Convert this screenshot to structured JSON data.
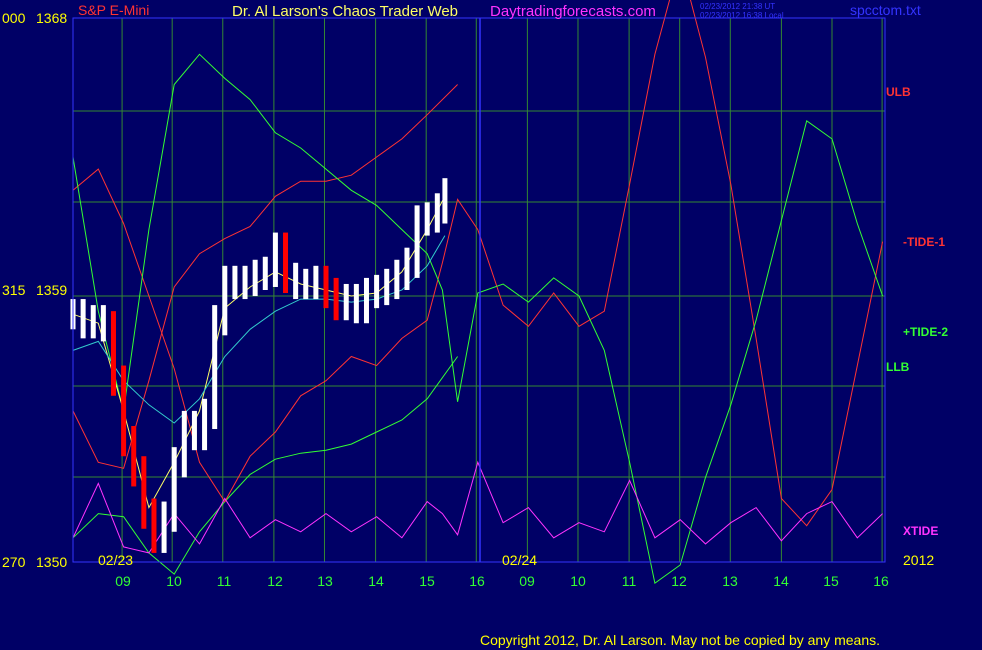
{
  "header": {
    "symbol": "S&P E-Mini",
    "title": "Dr. Al Larson's Chaos Trader Web",
    "site": "Daytradingforecasts.com",
    "timestamp_ut": "02/23/2012 21:38 UT",
    "timestamp_local": "02/23/2012 16:38 Local",
    "filename": "spcctom.txt"
  },
  "copyright": "Copyright 2012, Dr. Al Larson. May not be copied by any means.",
  "colors": {
    "background": "#000066",
    "frame": "#3333ff",
    "grid": "#338833",
    "axis_label": "#ffff00",
    "time_label": "#33ff33",
    "price_bars_up": "#ffffff",
    "price_bars_down": "#ff0000",
    "ulb": "#ff3333",
    "tide1": "#ff3333",
    "tide2": "#33ff33",
    "llb": "#33ff33",
    "xtide": "#ff33ff",
    "moving_avg_fast": "#ffff66",
    "moving_avg_slow": "#33cccc",
    "copyright": "#ffff00",
    "site": "#ff33ff",
    "title": "#ffff66",
    "symbol": "#ff3333"
  },
  "chart_data": {
    "type": "line",
    "y_axis": {
      "ticks": [
        {
          "left": "000",
          "right": "1368",
          "value": 1368
        },
        {
          "left": "315",
          "right": "1359",
          "value": 1359
        },
        {
          "left": "270",
          "right": "1350",
          "value": 1350
        }
      ],
      "ylim": [
        1350,
        1368
      ]
    },
    "x_axis": {
      "ticks": [
        "09",
        "10",
        "11",
        "12",
        "13",
        "14",
        "15",
        "16",
        "09",
        "10",
        "11",
        "12",
        "13",
        "14",
        "15",
        "16"
      ],
      "date_labels": [
        "02/23",
        "02/24"
      ],
      "year_label": "2012"
    },
    "series_labels": [
      {
        "name": "ULB",
        "color": "#ff3333"
      },
      {
        "name": "-TIDE-1",
        "color": "#ff3333"
      },
      {
        "name": "+TIDE-2",
        "color": "#33ff33"
      },
      {
        "name": "LLB",
        "color": "#33ff33"
      },
      {
        "name": "XTIDE",
        "color": "#ff33ff"
      }
    ],
    "series": [
      {
        "name": "ULB",
        "x": [
          0,
          0.5,
          1,
          1.5,
          2,
          2.5,
          3,
          3.5,
          4,
          4.5,
          5,
          5.5,
          6,
          6.5,
          7,
          7.6
        ],
        "y": [
          1355.0,
          1353.3,
          1353.1,
          1356.0,
          1359.1,
          1360.2,
          1360.7,
          1361.1,
          1362.1,
          1362.6,
          1362.6,
          1362.8,
          1363.4,
          1364.0,
          1364.8,
          1365.8
        ]
      },
      {
        "name": "LLB",
        "x": [
          0,
          0.5,
          1,
          1.5,
          2,
          2.5,
          3,
          3.5,
          4,
          4.5,
          5,
          5.5,
          6,
          6.5,
          7,
          7.6
        ],
        "y": [
          1350.8,
          1351.6,
          1351.5,
          1350.3,
          1349.6,
          1351.0,
          1352.0,
          1352.9,
          1353.4,
          1353.6,
          1353.7,
          1353.9,
          1354.3,
          1354.7,
          1355.4,
          1356.8
        ]
      },
      {
        "name": "-TIDE-1",
        "x": [
          0,
          0.5,
          1,
          1.5,
          2,
          2.5,
          3,
          3.5,
          4,
          4.5,
          5,
          5.5,
          6,
          6.5,
          7,
          7.3,
          7.6,
          8.0,
          8.5,
          9.0,
          9.5,
          10.0,
          10.5,
          11.0,
          11.5,
          12.0,
          12.5,
          13.0,
          13.5,
          14.0,
          14.5,
          15.0,
          15.5,
          16.0
        ],
        "y": [
          1362.3,
          1363.0,
          1361.2,
          1358.8,
          1356.4,
          1353.3,
          1352.0,
          1353.5,
          1354.3,
          1355.5,
          1356.0,
          1356.8,
          1356.5,
          1357.4,
          1358.0,
          1359.9,
          1362.0,
          1361.0,
          1358.5,
          1357.8,
          1358.9,
          1357.8,
          1358.3,
          1362.5,
          1366.8,
          1369.9,
          1366.7,
          1362.5,
          1357.4,
          1352.1,
          1351.2,
          1352.4,
          1356.5,
          1360.6
        ]
      },
      {
        "name": "+TIDE-2",
        "x": [
          0,
          0.5,
          1,
          1.5,
          2,
          2.5,
          3,
          3.5,
          4,
          4.5,
          5,
          5.5,
          6,
          6.5,
          7,
          7.3,
          7.6,
          8.0,
          8.5,
          9.0,
          9.5,
          10.0,
          10.5,
          11.0,
          11.5,
          12.0,
          12.5,
          13.0,
          13.5,
          14.0,
          14.5,
          15.0,
          15.5,
          16.0
        ],
        "y": [
          1363.4,
          1358.3,
          1355.0,
          1361.0,
          1365.8,
          1366.8,
          1366.0,
          1365.3,
          1364.2,
          1363.7,
          1363.0,
          1362.3,
          1361.8,
          1361.0,
          1360.2,
          1359.0,
          1355.3,
          1358.9,
          1359.2,
          1358.6,
          1359.4,
          1358.8,
          1357.0,
          1353.3,
          1349.3,
          1349.9,
          1352.8,
          1355.2,
          1358.0,
          1361.3,
          1364.6,
          1364.0,
          1361.2,
          1358.8
        ]
      },
      {
        "name": "XTIDE",
        "x": [
          0,
          0.5,
          1,
          1.5,
          2,
          2.5,
          3,
          3.5,
          4,
          4.5,
          5,
          5.5,
          6,
          6.5,
          7,
          7.3,
          7.6,
          8.0,
          8.5,
          9.0,
          9.5,
          10.0,
          10.5,
          11.0,
          11.5,
          12.0,
          12.5,
          13.0,
          13.5,
          14.0,
          14.5,
          15.0,
          15.5,
          16.0
        ],
        "y": [
          1350.8,
          1352.6,
          1350.5,
          1350.3,
          1351.6,
          1350.6,
          1352.1,
          1350.8,
          1351.4,
          1351.0,
          1351.6,
          1351.0,
          1351.5,
          1350.8,
          1352.0,
          1351.6,
          1350.9,
          1353.3,
          1351.3,
          1351.8,
          1350.8,
          1351.3,
          1351.0,
          1352.7,
          1350.8,
          1351.4,
          1350.6,
          1351.3,
          1351.8,
          1350.7,
          1351.6,
          1352.0,
          1350.8,
          1351.6
        ]
      },
      {
        "name": "price_close",
        "x": [
          0,
          0.2,
          0.4,
          0.6,
          0.8,
          1.0,
          1.2,
          1.4,
          1.6,
          1.8,
          2.0,
          2.2,
          2.4,
          2.6,
          2.8,
          3.0,
          3.2,
          3.4,
          3.6,
          3.8,
          4.0,
          4.2,
          4.4,
          4.6,
          4.8,
          5.0,
          5.2,
          5.4,
          5.6,
          5.8,
          6.0,
          6.2,
          6.4,
          6.6,
          6.8,
          7.0,
          7.2,
          7.35
        ],
        "y": [
          1358.2,
          1357.9,
          1358.0,
          1357.8,
          1356.0,
          1354.0,
          1353.0,
          1351.6,
          1350.8,
          1351.5,
          1353.3,
          1354.5,
          1354.2,
          1354.9,
          1358.0,
          1359.3,
          1359.2,
          1359.3,
          1359.5,
          1359.6,
          1360.4,
          1359.4,
          1359.2,
          1359.2,
          1359.3,
          1358.9,
          1358.5,
          1358.7,
          1358.4,
          1358.9,
          1359.0,
          1359.2,
          1359.5,
          1359.9,
          1361.3,
          1361.4,
          1361.7,
          1362.2
        ]
      },
      {
        "name": "moving_avg_fast",
        "x": [
          0,
          0.5,
          1,
          1.5,
          2,
          2.5,
          3,
          3.5,
          4,
          4.5,
          5,
          5.5,
          6,
          6.5,
          7,
          7.35
        ],
        "y": [
          1358.2,
          1357.9,
          1355.0,
          1351.8,
          1353.3,
          1355.0,
          1358.4,
          1359.1,
          1359.6,
          1359.2,
          1359.0,
          1358.8,
          1358.9,
          1359.6,
          1361.0,
          1362.1
        ]
      },
      {
        "name": "moving_avg_slow",
        "x": [
          0,
          0.5,
          1,
          1.5,
          2,
          2.5,
          3,
          3.5,
          4,
          4.5,
          5,
          5.5,
          6,
          6.5,
          7,
          7.35
        ],
        "y": [
          1357.0,
          1357.3,
          1356.0,
          1355.2,
          1354.6,
          1355.4,
          1356.8,
          1357.7,
          1358.3,
          1358.7,
          1358.7,
          1358.6,
          1358.7,
          1359.0,
          1359.8,
          1360.8
        ]
      }
    ]
  }
}
